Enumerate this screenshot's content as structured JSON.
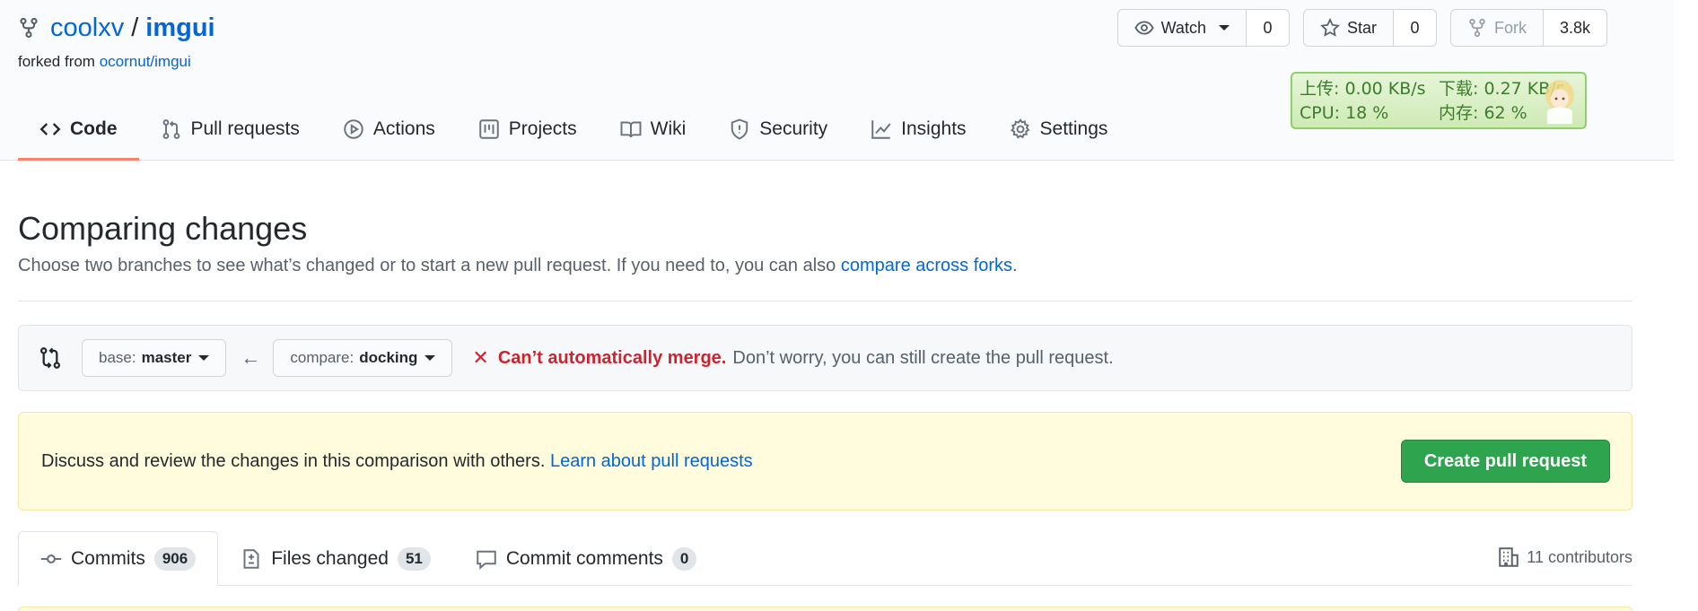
{
  "repo": {
    "owner": "coolxv",
    "separator": "/",
    "name": "imgui",
    "forked_from_label": "forked from",
    "forked_from_link": "ocornut/imgui"
  },
  "actions": {
    "watch": {
      "label": "Watch",
      "count": "0"
    },
    "star": {
      "label": "Star",
      "count": "0"
    },
    "fork": {
      "label": "Fork",
      "count": "3.8k"
    }
  },
  "nav": [
    {
      "label": "Code",
      "icon": "code-icon",
      "selected": true
    },
    {
      "label": "Pull requests",
      "icon": "git-pull-request-icon"
    },
    {
      "label": "Actions",
      "icon": "play-icon"
    },
    {
      "label": "Projects",
      "icon": "project-icon"
    },
    {
      "label": "Wiki",
      "icon": "book-icon"
    },
    {
      "label": "Security",
      "icon": "shield-icon"
    },
    {
      "label": "Insights",
      "icon": "graph-icon"
    },
    {
      "label": "Settings",
      "icon": "gear-icon"
    }
  ],
  "netmon": {
    "upload": "上传: 0.00 KB/s",
    "download": "下载: 0.27 KB/s",
    "cpu": "CPU: 18 %",
    "memory": "内存: 62 %"
  },
  "compare": {
    "title": "Comparing changes",
    "description": "Choose two branches to see what’s changed or to start a new pull request. If you need to, you can also",
    "description_link": "compare across forks",
    "description_end": ".",
    "base_label": "base:",
    "base_branch": "master",
    "compare_label": "compare:",
    "compare_branch": "docking",
    "arrow": "←",
    "merge_error": "Can’t automatically merge.",
    "merge_note": "Don’t worry, you can still create the pull request."
  },
  "pr_box": {
    "message": "Discuss and review the changes in this comparison with others.",
    "link": "Learn about pull requests",
    "button": "Create pull request"
  },
  "tabs": [
    {
      "label": "Commits",
      "count": "906",
      "icon": "git-commit-icon",
      "selected": true
    },
    {
      "label": "Files changed",
      "count": "51",
      "icon": "file-diff-icon"
    },
    {
      "label": "Commit comments",
      "count": "0",
      "icon": "comment-icon"
    }
  ],
  "contributors": "11 contributors",
  "colors": {
    "link": "#0366d6",
    "accent_underline": "#f9826c",
    "primary_button": "#2ea44f",
    "error": "#cb2431",
    "flash_bg": "#fffbdd"
  }
}
